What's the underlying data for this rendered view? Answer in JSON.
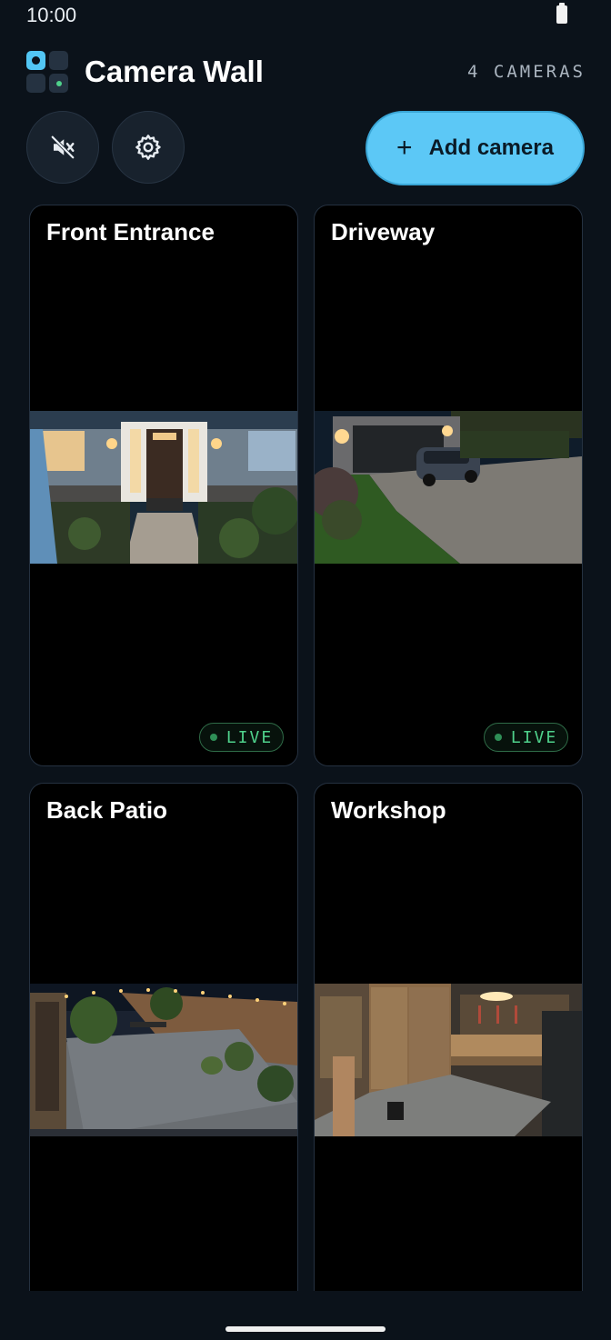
{
  "status_bar": {
    "time": "10:00",
    "battery_icon": "battery-icon"
  },
  "header": {
    "logo_icon": "grid-camera-logo",
    "title": "Camera Wall",
    "camera_count": "4 CAMERAS"
  },
  "toolbar": {
    "mute_icon": "speaker-muted-icon",
    "settings_icon": "gear-icon",
    "add_label": "Add camera",
    "add_icon": "plus-icon"
  },
  "cameras": [
    {
      "name": "Front Entrance",
      "status": "LIVE"
    },
    {
      "name": "Driveway",
      "status": "LIVE"
    },
    {
      "name": "Back Patio"
    },
    {
      "name": "Workshop"
    }
  ],
  "colors": {
    "background": "#0b121a",
    "accent": "#5cc8f6",
    "live_green": "#4fd18b"
  }
}
